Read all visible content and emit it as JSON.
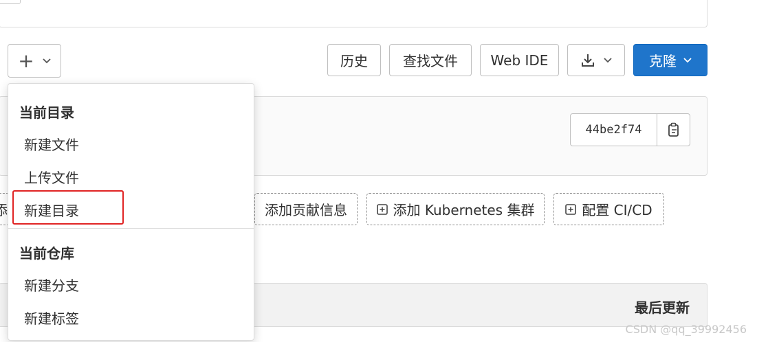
{
  "toolbar": {
    "plus_symbol": "+",
    "history": "历史",
    "find_file": "查找文件",
    "web_ide": "Web IDE",
    "clone": "克隆"
  },
  "commit": {
    "sha": "44be2f74"
  },
  "shortcuts": {
    "hidden_fragment": "添",
    "add_contributing": "添加贡献信息",
    "add_kubernetes": "添加 Kubernetes 集群",
    "setup_cicd": "配置 CI/CD"
  },
  "table": {
    "last_update": "最后更新"
  },
  "dropdown": {
    "section_current_dir": "当前目录",
    "new_file": "新建文件",
    "upload_file": "上传文件",
    "new_directory": "新建目录",
    "section_current_repo": "当前仓库",
    "new_branch": "新建分支",
    "new_tag": "新建标签"
  },
  "watermark": "CSDN @qq_39992456",
  "colors": {
    "primary": "#1f75cb",
    "highlight_box": "#e02323"
  },
  "icons": [
    "plus-icon",
    "chevron-down-icon",
    "download-icon",
    "copy-icon",
    "plus-square-icon"
  ]
}
